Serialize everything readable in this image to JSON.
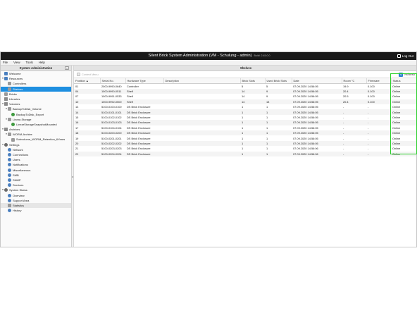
{
  "titlebar": {
    "title": "Silent Brick System Administration (VM - Schulung - admin)",
    "build": "Build: 2.45.0.0",
    "logout": "Log Out"
  },
  "menubar": [
    "File",
    "View",
    "Tools",
    "Help"
  ],
  "sidebar": {
    "header": "System Administration",
    "collapse_icon": "chevron-left-icon",
    "items": [
      {
        "label": "Welcome",
        "indent": 0,
        "toggle": "",
        "icon": "blue"
      },
      {
        "label": "Resources",
        "indent": 0,
        "toggle": "▾",
        "icon": "blue"
      },
      {
        "label": "Controllers",
        "indent": 1,
        "toggle": "",
        "icon": "grey"
      },
      {
        "label": "Shelves",
        "indent": 1,
        "toggle": "",
        "icon": "grey",
        "selected": true
      },
      {
        "label": "Bricks",
        "indent": 0,
        "toggle": "",
        "icon": "grey"
      },
      {
        "label": "Libraries",
        "indent": 0,
        "toggle": "",
        "icon": "folder"
      },
      {
        "label": "Volumes",
        "indent": 0,
        "toggle": "▾",
        "icon": "folder"
      },
      {
        "label": "BackupToDisk_Volume",
        "indent": 1,
        "toggle": "▾",
        "icon": "grey"
      },
      {
        "label": "BackupToDisk_Export",
        "indent": 2,
        "toggle": "",
        "icon": "green"
      },
      {
        "label": "Linear-Storage",
        "indent": 1,
        "toggle": "▾",
        "icon": "grey"
      },
      {
        "label": "LinearStorageSnapshotMounted",
        "indent": 2,
        "toggle": "",
        "icon": "green"
      },
      {
        "label": "Archives",
        "indent": 0,
        "toggle": "▾",
        "icon": "folder"
      },
      {
        "label": "WORM-Archive",
        "indent": 1,
        "toggle": "▾",
        "icon": "grey"
      },
      {
        "label": "Subvolume_WORM_Retention_6Years",
        "indent": 2,
        "toggle": "",
        "icon": "grey"
      },
      {
        "label": "Settings",
        "indent": 0,
        "toggle": "▾",
        "icon": "gear"
      },
      {
        "label": "Network",
        "indent": 1,
        "toggle": "",
        "icon": "round"
      },
      {
        "label": "Connections",
        "indent": 1,
        "toggle": "",
        "icon": "round"
      },
      {
        "label": "Users",
        "indent": 1,
        "toggle": "",
        "icon": "round"
      },
      {
        "label": "Notifications",
        "indent": 1,
        "toggle": "",
        "icon": "round"
      },
      {
        "label": "Miscellaneous",
        "indent": 1,
        "toggle": "",
        "icon": "round"
      },
      {
        "label": "SMB",
        "indent": 1,
        "toggle": "",
        "icon": "round"
      },
      {
        "label": "SNMP",
        "indent": 1,
        "toggle": "",
        "icon": "round"
      },
      {
        "label": "Services",
        "indent": 1,
        "toggle": "",
        "icon": "round"
      },
      {
        "label": "System Status",
        "indent": 0,
        "toggle": "▾",
        "icon": "gear"
      },
      {
        "label": "Overview",
        "indent": 1,
        "toggle": "",
        "icon": "round"
      },
      {
        "label": "Support Area",
        "indent": 1,
        "toggle": "",
        "icon": "round"
      },
      {
        "label": "Statistics",
        "indent": 1,
        "toggle": "",
        "icon": "grey",
        "selected_light": true
      },
      {
        "label": "History",
        "indent": 1,
        "toggle": "",
        "icon": "round"
      }
    ]
  },
  "main": {
    "header": "Shelves",
    "context_menu": "Context Menu",
    "refresh": "Refresh",
    "columns": [
      "Position ▲",
      "Serial No.",
      "Hardware Type",
      "Description",
      "Brick Slots",
      "Used Brick Slots",
      "Date",
      "Room °C",
      "Firmware",
      "Status"
    ],
    "rows": [
      [
        "01",
        "2000-9990-0640",
        "Controller",
        "",
        "5",
        "5",
        "07.09.2020 14:56:05",
        "19.9",
        "0.100",
        "Online"
      ],
      [
        "04",
        "1000-9990-0511",
        "Shelf",
        "",
        "14",
        "9",
        "07.09.2020 14:56:05",
        "20.4",
        "0.100",
        "Online"
      ],
      [
        "07",
        "1000-9991-0533",
        "Shelf",
        "",
        "14",
        "9",
        "07.09.2020 14:56:05",
        "20.5",
        "0.100",
        "Online"
      ],
      [
        "10",
        "1000-9992-0500",
        "Shelf",
        "",
        "14",
        "13",
        "07.09.2020 14:56:05",
        "20.4",
        "0.100",
        "Online"
      ],
      [
        "13",
        "5100-0100-0100",
        "DS Brick Enclosure",
        "",
        "1",
        "1",
        "07.09.2020 14:56:05",
        "-",
        "-",
        "Online"
      ],
      [
        "14",
        "5100-0101-0101",
        "DS Brick Enclosure",
        "",
        "1",
        "1",
        "07.09.2020 14:56:05",
        "-",
        "-",
        "Online"
      ],
      [
        "15",
        "5100-0102-0102",
        "DS Brick Enclosure",
        "",
        "1",
        "1",
        "07.09.2020 14:56:05",
        "-",
        "-",
        "Online"
      ],
      [
        "16",
        "5100-0103-0103",
        "DS Brick Enclosure",
        "",
        "1",
        "1",
        "07.09.2020 14:56:05",
        "-",
        "-",
        "Online"
      ],
      [
        "17",
        "5100-0104-0104",
        "DS Brick Enclosure",
        "",
        "1",
        "1",
        "07.09.2020 14:56:05",
        "-",
        "-",
        "Online"
      ],
      [
        "18",
        "5100-0200-0200",
        "DS Brick Enclosure",
        "",
        "1",
        "1",
        "07.09.2020 14:56:05",
        "-",
        "-",
        "Online"
      ],
      [
        "19",
        "5100-0201-0201",
        "DS Brick Enclosure",
        "",
        "1",
        "1",
        "07.09.2020 14:56:05",
        "-",
        "-",
        "Online"
      ],
      [
        "20",
        "5100-0202-0202",
        "DS Brick Enclosure",
        "",
        "1",
        "1",
        "07.09.2020 14:56:05",
        "-",
        "-",
        "Online"
      ],
      [
        "21",
        "5100-0203-0203",
        "DS Brick Enclosure",
        "",
        "1",
        "1",
        "07.09.2020 14:56:06",
        "-",
        "-",
        "Online"
      ],
      [
        "22",
        "5100-0204-0204",
        "DS Brick Enclosure",
        "",
        "1",
        "1",
        "07.09.2020 14:56:06",
        "-",
        "-",
        "Online"
      ]
    ]
  },
  "colors": {
    "titlebar_bg": "#1a1a1a",
    "selection": "#1e8fe0",
    "highlight_box": "#2ed12e"
  }
}
